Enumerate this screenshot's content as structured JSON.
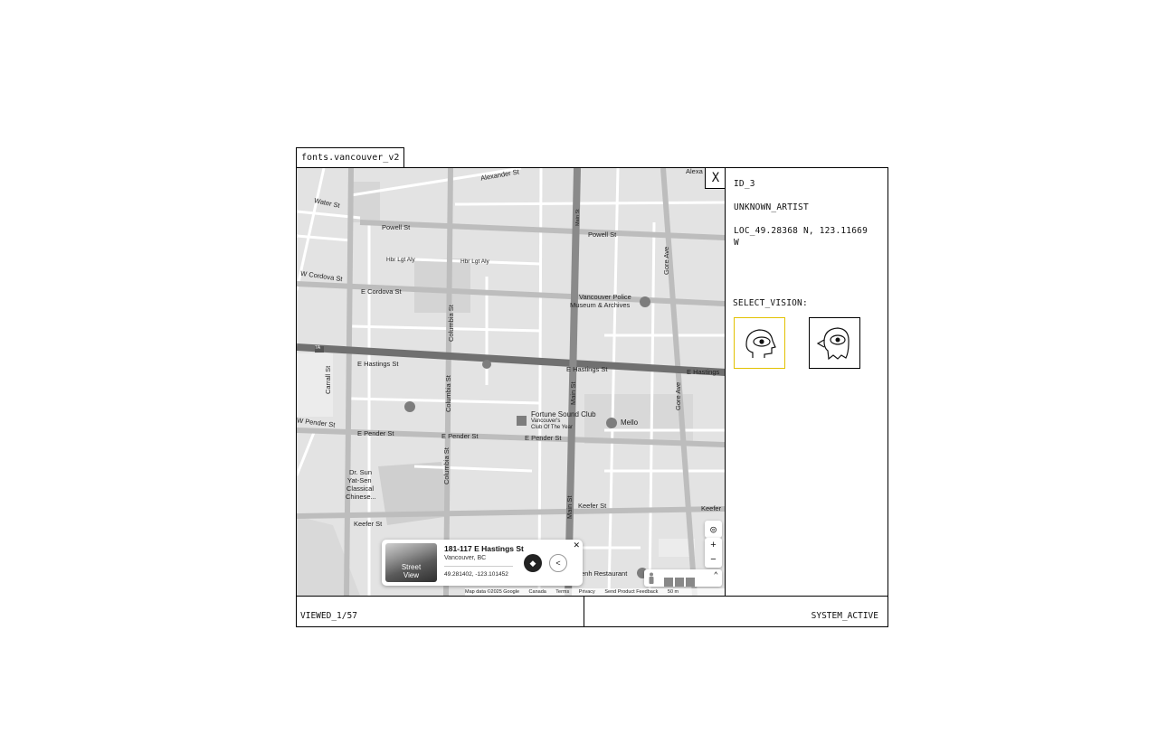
{
  "window": {
    "title": "fonts.vancouver_v2",
    "close_label": "X"
  },
  "info": {
    "id": "ID_3",
    "artist": "UNKNOWN_ARTIST",
    "location_line1": "LOC_49.28368 N, 123.11669",
    "location_line2": "W",
    "select_label": "SELECT_VISION:",
    "vision_options": [
      {
        "icon": "human-head-eye-icon",
        "selected": true
      },
      {
        "icon": "bird-head-eye-icon",
        "selected": false
      }
    ],
    "selected_color": "#e2c100"
  },
  "footer": {
    "viewed": "VIEWED_1/57",
    "status": "SYSTEM_ACTIVE"
  },
  "map": {
    "streets": {
      "alexander": "Alexander St",
      "alexa": "Alexa",
      "water": "Water St",
      "powell_w": "Powell St",
      "powell_e": "Powell St",
      "hbr1": "Hbr Lgt Aly",
      "hbr2": "Hbr Lgt Aly",
      "w_cordova": "W Cordova St",
      "e_cordova": "E Cordova St",
      "hastings_w": "E Hastings St",
      "hastings_m": "E Hastings St",
      "hastings_e": "E Hastings",
      "w_pender": "W Pender St",
      "pender_w": "E Pender St",
      "pender_m": "E Pender St",
      "pender_e": "E Pender St",
      "keefer_w": "Keefer St",
      "keefer_m": "Keefer St",
      "keefer_e": "Keefer",
      "carrall": "Carrall St",
      "columbia_n": "Columbia St",
      "columbia_m": "Columbia St",
      "columbia_s": "Columbia St",
      "main_n": "Main St",
      "main_m": "Main St",
      "main_s": "Main St",
      "gore_n": "Gore Ave",
      "gore_s": "Gore Ave",
      "route_badge": "7A"
    },
    "pois": {
      "police_1": "Vancouver Police",
      "police_2": "Museum & Archives",
      "fortune": "Fortune Sound Club",
      "year_1": "Vancouver's",
      "year_2": "Club Of The Year",
      "mello": "Mello",
      "drsun_1": "Dr. Sun",
      "drsun_2": "Yat-Sen",
      "drsun_3": "Classical",
      "drsun_4": "Chinese...",
      "restaurant": "enh Restaurant"
    },
    "popup": {
      "address": "181-117 E Hastings St",
      "city": "Vancouver, BC",
      "coords": "49.281402, -123.101452",
      "thumb_line1": "Street",
      "thumb_line2": "View",
      "close": "✕",
      "directions_icon": "◆",
      "share_icon": "<"
    },
    "controls": {
      "zoom_in": "+",
      "zoom_out": "−",
      "locate_icon": "◎",
      "expand": "⌃"
    },
    "attribution": [
      "Map data ©2025 Google",
      "Canada",
      "Terms",
      "Privacy",
      "Send Product Feedback",
      "50 m"
    ]
  }
}
